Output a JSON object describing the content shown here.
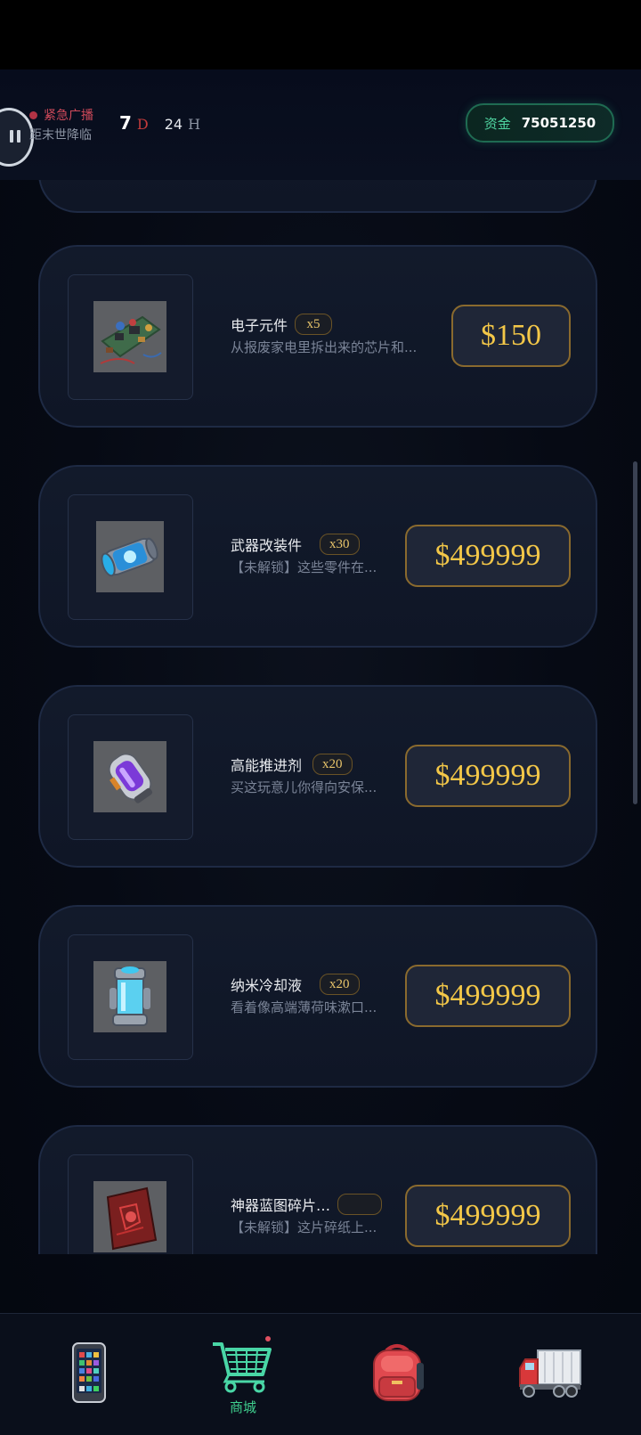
{
  "header": {
    "broadcast_title": "紧急广播",
    "broadcast_subtitle": "距末世降临",
    "countdown_days": "7",
    "countdown_day_unit": "D",
    "countdown_hours": "24",
    "countdown_hour_unit": "H",
    "funds_label": "资金",
    "funds_value": "75051250"
  },
  "shop": {
    "items": [
      {
        "name": "电子元件",
        "qty": "x5",
        "desc": "从报废家电里拆出来的芯片和...",
        "price": "$150",
        "icon": "circuit-board-icon"
      },
      {
        "name": "武器改装件",
        "qty": "x30",
        "desc": "【未解锁】这些零件在...",
        "price": "$499999",
        "icon": "energy-capsule-icon"
      },
      {
        "name": "高能推进剂",
        "qty": "x20",
        "desc": "买这玩意儿你得向安保...",
        "price": "$499999",
        "icon": "propellant-canister-icon"
      },
      {
        "name": "纳米冷却液",
        "qty": "x20",
        "desc": "看着像高端薄荷味漱口...",
        "price": "$499999",
        "icon": "coolant-tank-icon"
      },
      {
        "name": "神器蓝图碎片…",
        "qty": "",
        "desc": "【未解锁】这片碎纸上...",
        "price": "$499999",
        "icon": "blueprint-fragment-icon"
      }
    ]
  },
  "nav": {
    "items": [
      {
        "icon": "phone-icon",
        "label": ""
      },
      {
        "icon": "shopping-cart-icon",
        "label": "商城"
      },
      {
        "icon": "backpack-icon",
        "label": ""
      },
      {
        "icon": "truck-icon",
        "label": ""
      }
    ],
    "active_color": "#3fcf8e"
  }
}
